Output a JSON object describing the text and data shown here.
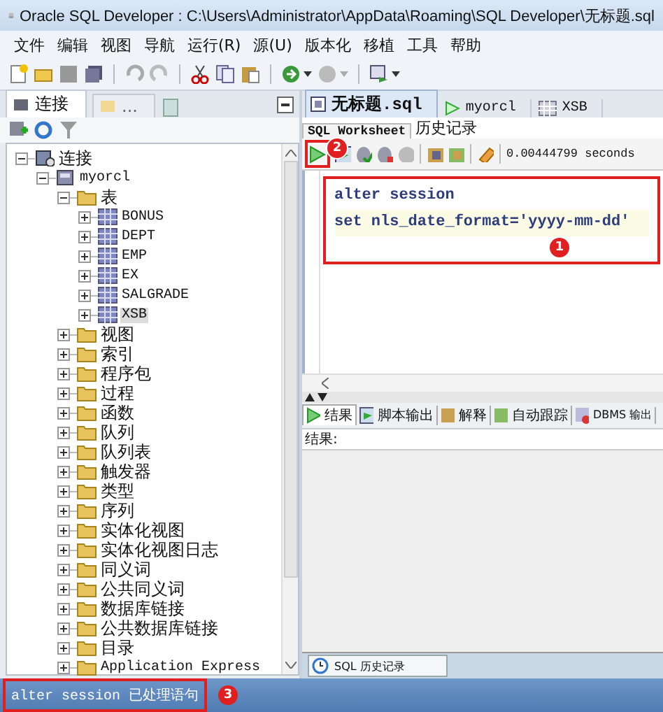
{
  "window": {
    "title": "Oracle SQL Developer : C:\\Users\\Administrator\\AppData\\Roaming\\SQL Developer\\无标题.sql"
  },
  "menu": [
    "文件",
    "编辑",
    "视图",
    "导航",
    "运行(R)",
    "源(U)",
    "版本化",
    "移植",
    "工具",
    "帮助"
  ],
  "left_tabs": [
    {
      "label": "连接",
      "selected": true
    },
    {
      "label": "...",
      "selected": false
    }
  ],
  "tree": [
    {
      "label": "连接",
      "kind": "connection",
      "expanded": true,
      "selected": false,
      "children": [
        {
          "label": "myorcl",
          "kind": "database",
          "expanded": true,
          "selected": false,
          "children": [
            {
              "label": "表",
              "kind": "folder",
              "expanded": true,
              "selected": false,
              "children": [
                {
                  "label": "BONUS",
                  "kind": "table",
                  "expanded": false,
                  "selected": false
                },
                {
                  "label": "DEPT",
                  "kind": "table",
                  "expanded": false,
                  "selected": false
                },
                {
                  "label": "EMP",
                  "kind": "table",
                  "expanded": false,
                  "selected": false
                },
                {
                  "label": "EX",
                  "kind": "table",
                  "expanded": false,
                  "selected": false
                },
                {
                  "label": "SALGRADE",
                  "kind": "table",
                  "expanded": false,
                  "selected": false
                },
                {
                  "label": "XSB",
                  "kind": "table",
                  "expanded": false,
                  "selected": true
                }
              ]
            },
            {
              "label": "视图",
              "kind": "folder",
              "expanded": false,
              "selected": false
            },
            {
              "label": "索引",
              "kind": "folder",
              "expanded": false,
              "selected": false
            },
            {
              "label": "程序包",
              "kind": "folder",
              "expanded": false,
              "selected": false
            },
            {
              "label": "过程",
              "kind": "folder",
              "expanded": false,
              "selected": false
            },
            {
              "label": "函数",
              "kind": "folder",
              "expanded": false,
              "selected": false
            },
            {
              "label": "队列",
              "kind": "folder",
              "expanded": false,
              "selected": false
            },
            {
              "label": "队列表",
              "kind": "folder",
              "expanded": false,
              "selected": false
            },
            {
              "label": "触发器",
              "kind": "folder",
              "expanded": false,
              "selected": false
            },
            {
              "label": "类型",
              "kind": "folder",
              "expanded": false,
              "selected": false
            },
            {
              "label": "序列",
              "kind": "folder",
              "expanded": false,
              "selected": false
            },
            {
              "label": "实体化视图",
              "kind": "folder",
              "expanded": false,
              "selected": false
            },
            {
              "label": "实体化视图日志",
              "kind": "folder",
              "expanded": false,
              "selected": false
            },
            {
              "label": "同义词",
              "kind": "folder",
              "expanded": false,
              "selected": false
            },
            {
              "label": "公共同义词",
              "kind": "folder",
              "expanded": false,
              "selected": false
            },
            {
              "label": "数据库链接",
              "kind": "folder",
              "expanded": false,
              "selected": false
            },
            {
              "label": "公共数据库链接",
              "kind": "folder",
              "expanded": false,
              "selected": false
            },
            {
              "label": "目录",
              "kind": "folder",
              "expanded": false,
              "selected": false
            },
            {
              "label": "Application Express",
              "kind": "folder",
              "expanded": false,
              "selected": false
            }
          ]
        }
      ]
    }
  ],
  "doc_tabs": [
    {
      "label": "无标题.sql",
      "kind": "sql",
      "selected": true
    },
    {
      "label": "myorcl",
      "kind": "connection",
      "selected": false
    },
    {
      "label": "XSB",
      "kind": "table",
      "selected": false
    }
  ],
  "sub_tabs": [
    {
      "label": "SQL Worksheet",
      "selected": true
    },
    {
      "label": "历史记录",
      "selected": false
    }
  ],
  "elapsed": "0.00444799 seconds",
  "editor_lines": [
    "alter session",
    "set nls_date_format='yyyy-mm-dd'"
  ],
  "output_tabs": [
    {
      "label": "结果",
      "kind": "run",
      "selected": true
    },
    {
      "label": "脚本输出",
      "kind": "script",
      "selected": false
    },
    {
      "label": "解释",
      "kind": "explain",
      "selected": false
    },
    {
      "label": "自动跟踪",
      "kind": "trace",
      "selected": false
    },
    {
      "label": "DBMS 输出",
      "kind": "dbms",
      "selected": false
    }
  ],
  "results_label": "结果:",
  "history_tab": "SQL 历史记录",
  "status": "alter session 已处理语句",
  "badges": [
    "1",
    "2",
    "3"
  ]
}
